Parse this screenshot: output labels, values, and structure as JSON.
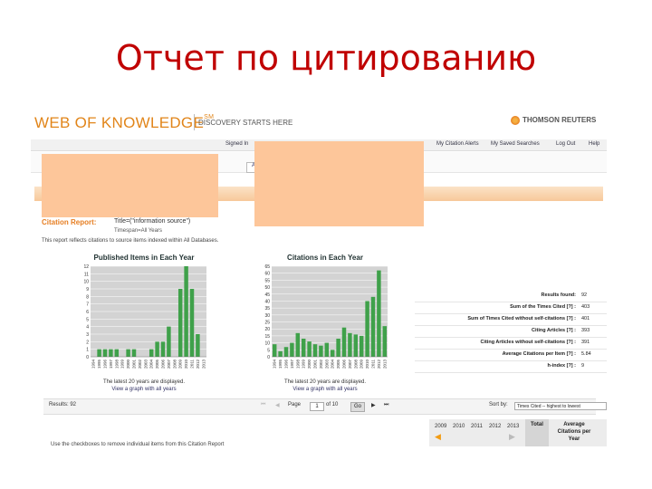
{
  "slide": {
    "title": "Отчет по цитированию"
  },
  "header": {
    "logo_text": "WEB OF KNOWLEDGE",
    "logo_tm": "SM",
    "tagline": "DISCOVERY STARTS HERE",
    "brand": "THOMSON REUTERS"
  },
  "topbar": {
    "signed_in": "Signed In",
    "links": [
      "My Citation Alerts",
      "My Saved Searches",
      "Log Out",
      "Help"
    ]
  },
  "report": {
    "title": "Citation Report:",
    "query": "Title=(\"information source\")",
    "timespan": "Timespan=All Years",
    "note": "This report reflects citations to source items indexed within All Databases."
  },
  "charts": [
    {
      "title": "Published Items in Each Year",
      "note_line1": "The latest 20 years are displayed.",
      "note_link": "View a graph with all years",
      "chart_data": {
        "type": "bar",
        "title": "Published Items in Each Year",
        "categories": [
          "1994",
          "1995",
          "1996",
          "1997",
          "1998",
          "1999",
          "2000",
          "2001",
          "2002",
          "2003",
          "2004",
          "2005",
          "2006",
          "2007",
          "2008",
          "2009",
          "2010",
          "2011",
          "2012",
          "2013"
        ],
        "values": [
          0,
          1,
          1,
          1,
          1,
          0,
          1,
          1,
          0,
          0,
          1,
          2,
          2,
          4,
          0,
          9,
          12,
          9,
          3,
          0
        ],
        "ylim": [
          0,
          12
        ],
        "yticks": [
          0,
          1,
          2,
          3,
          4,
          5,
          6,
          7,
          8,
          9,
          10,
          11,
          12
        ]
      }
    },
    {
      "title": "Citations in Each Year",
      "note_line1": "The latest 20 years are displayed.",
      "note_link": "View a graph with all years",
      "chart_data": {
        "type": "bar",
        "title": "Citations in Each Year",
        "categories": [
          "1994",
          "1995",
          "1996",
          "1997",
          "1998",
          "1999",
          "2000",
          "2001",
          "2002",
          "2003",
          "2004",
          "2005",
          "2006",
          "2007",
          "2008",
          "2009",
          "2010",
          "2011",
          "2012",
          "2013"
        ],
        "values": [
          9,
          4,
          7,
          10,
          17,
          13,
          11,
          9,
          8,
          10,
          5,
          13,
          21,
          17,
          16,
          15,
          40,
          43,
          62,
          22
        ],
        "ylim": [
          0,
          65
        ],
        "yticks": [
          0,
          5,
          10,
          15,
          20,
          25,
          30,
          35,
          40,
          45,
          50,
          55,
          60,
          65
        ]
      }
    }
  ],
  "stats": [
    {
      "label": "Results found:",
      "value": "92"
    },
    {
      "label": "Sum of the Times Cited [?] :",
      "value": "403"
    },
    {
      "label": "Sum of Times Cited without self-citations [?] :",
      "value": "401"
    },
    {
      "label": "Citing Articles [?] :",
      "value": "393"
    },
    {
      "label": "Citing Articles without self-citations [?] :",
      "value": "391"
    },
    {
      "label": "Average Citations per Item [?] :",
      "value": "5.84"
    },
    {
      "label": "h-index [?] :",
      "value": "9"
    }
  ],
  "pager": {
    "results": "Results: 92",
    "page_label": "Page",
    "page_value": "1",
    "of_label": "of 10",
    "go": "Go",
    "sort_label": "Sort by:",
    "sort_value": "Times Cited -- highest to lowest"
  },
  "year_header": {
    "years": [
      "2009",
      "2010",
      "2011",
      "2012",
      "2013"
    ],
    "total": "Total",
    "average": "Average Citations per Year"
  },
  "bottom": {
    "hint": "Use the checkboxes to remove individual items from this Citation Report"
  },
  "colors": {
    "accent": "#e67e22",
    "bar": "#3fa14a",
    "title": "#c00000",
    "redaction": "#fdc69a"
  }
}
